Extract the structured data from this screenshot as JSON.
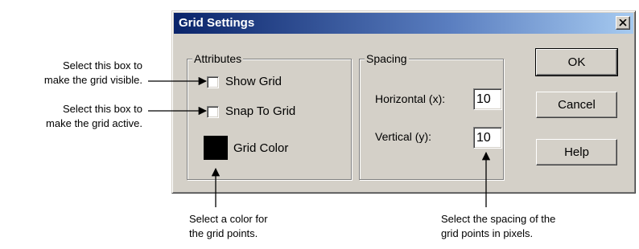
{
  "dialog": {
    "title": "Grid Settings",
    "close_icon": "close-x-icon"
  },
  "attributes": {
    "legend": "Attributes",
    "show_grid": {
      "label": "Show Grid",
      "checked": false
    },
    "snap_to_grid": {
      "label": "Snap To Grid",
      "checked": false
    },
    "grid_color": {
      "label": "Grid Color",
      "value": "#000000"
    }
  },
  "spacing": {
    "legend": "Spacing",
    "horizontal": {
      "label": "Horizontal (x):",
      "value": "10"
    },
    "vertical": {
      "label": "Vertical (y):",
      "value": "10"
    }
  },
  "buttons": {
    "ok": "OK",
    "cancel": "Cancel",
    "help": "Help"
  },
  "annotations": {
    "show_grid": [
      "Select this box to",
      "make the grid visible."
    ],
    "snap_to_grid": [
      "Select this box to",
      "make the grid active."
    ],
    "grid_color": [
      "Select a color for",
      "the grid points."
    ],
    "spacing": [
      "Select the spacing of the",
      "grid points in pixels."
    ]
  },
  "colors": {
    "dialog_face": "#d4d0c8",
    "title_bar_start": "#0a246a",
    "title_bar_end": "#a6caf0",
    "title_text": "#ffffff"
  }
}
